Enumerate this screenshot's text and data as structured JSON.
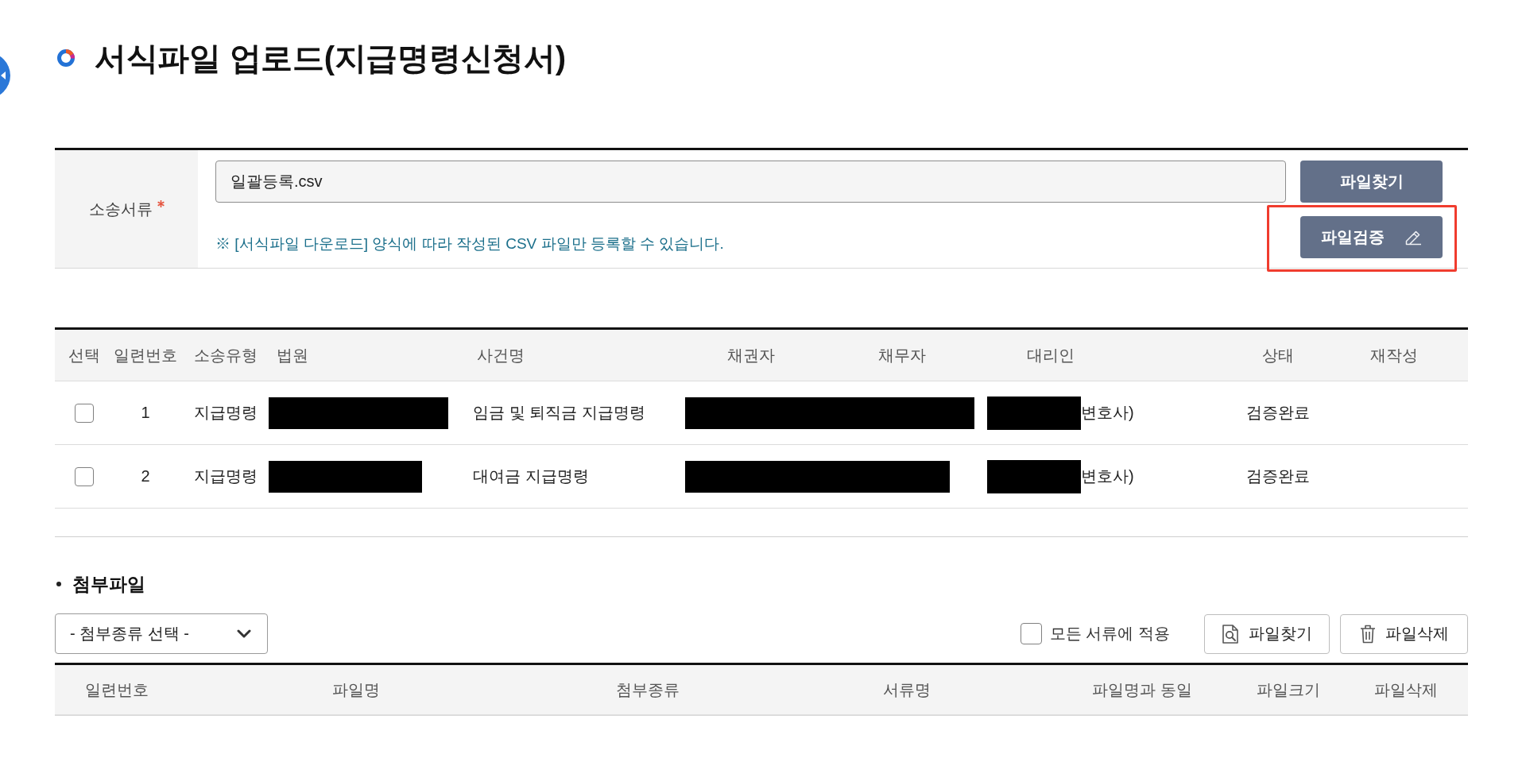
{
  "page": {
    "title": "서식파일 업로드(지급명령신청서)"
  },
  "upload_form": {
    "label": "소송서류",
    "required": true,
    "file_field": {
      "value": "일괄등록.csv"
    },
    "note": "※ [서식파일 다운로드] 양식에 따라 작성된 CSV 파일만 등록할 수 있습니다.",
    "buttons": [
      {
        "label": "파일찾기",
        "kind": "browse",
        "highlighted": false
      },
      {
        "label": "파일검증",
        "kind": "verify",
        "highlighted": true
      }
    ]
  },
  "file_table": {
    "columns": [
      "선택",
      "일련번호",
      "소송유형",
      "법원",
      "사건명",
      "채권자",
      "채무자",
      "대리인",
      "상태",
      "재작성"
    ],
    "rows": [
      {
        "selected": false,
        "serial": "1",
        "suit_type": "지급명령",
        "court_redacted": true,
        "case_name": "임금 및 퇴직금 지급명령",
        "parties_redacted": true,
        "agent_redacted": true,
        "agent": "변호사)",
        "status": "검증완료"
      },
      {
        "selected": false,
        "serial": "2",
        "suit_type": "지급명령",
        "court_redacted": true,
        "case_name": "대여금 지급명령",
        "parties_redacted": true,
        "agent_redacted": true,
        "agent": "변호사)",
        "status": "검증완료"
      }
    ]
  },
  "attachments": {
    "title": "첨부파일",
    "type_select": {
      "value": "- 첨부종류 선택 -"
    },
    "apply_all": {
      "label": "모든 서류에 적용",
      "checked": false
    },
    "buttons": [
      {
        "label": "파일찾기",
        "kind": "find"
      },
      {
        "label": "파일삭제",
        "kind": "delete"
      }
    ],
    "columns": [
      "일련번호",
      "파일명",
      "첨부종류",
      "서류명",
      "파일명과 동일",
      "파일크기",
      "파일삭제"
    ]
  }
}
